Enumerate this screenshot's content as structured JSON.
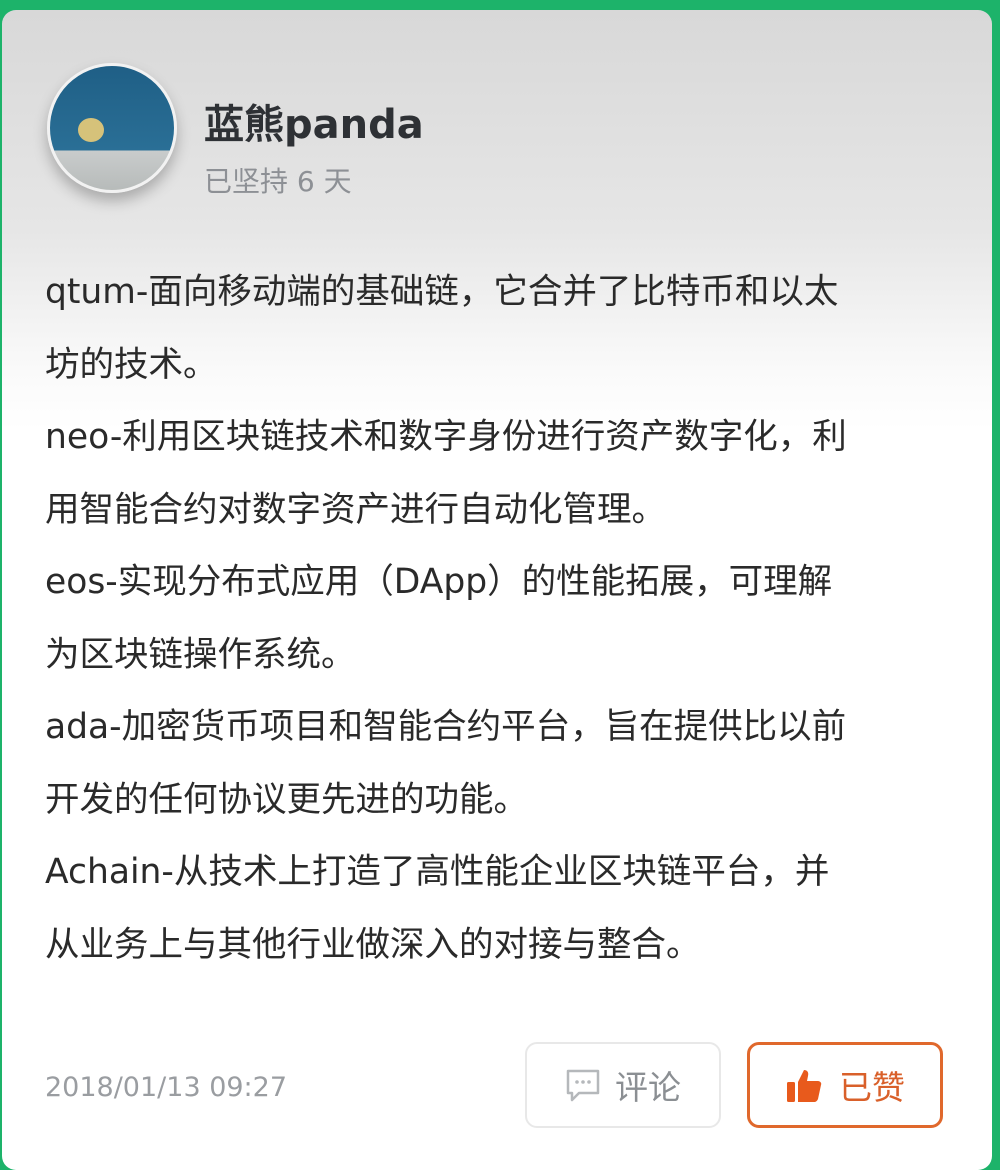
{
  "user": {
    "name": "蓝熊panda",
    "streak": "已坚持 6 天"
  },
  "post": {
    "lines": [
      "qtum-面向移动端的基础链，它合并了比特币和以太",
      "坊的技术。",
      "neo-利用区块链技术和数字身份进行资产数字化，利",
      "用智能合约对数字资产进行自动化管理。",
      "eos-实现分布式应用（DApp）的性能拓展，可理解",
      "为区块链操作系统。",
      "ada-加密货币项目和智能合约平台，旨在提供比以前",
      "开发的任何协议更先进的功能。",
      "Achain-从技术上打造了高性能企业区块链平台，并",
      "从业务上与其他行业做深入的对接与整合。"
    ],
    "timestamp": "2018/01/13 09:27"
  },
  "actions": {
    "comment_label": "评论",
    "like_label": "已赞",
    "comment_icon": "comment-bubble-icon",
    "like_icon": "thumbs-up-icon"
  },
  "colors": {
    "accent": "#e0682c",
    "header": "#1db36a"
  }
}
